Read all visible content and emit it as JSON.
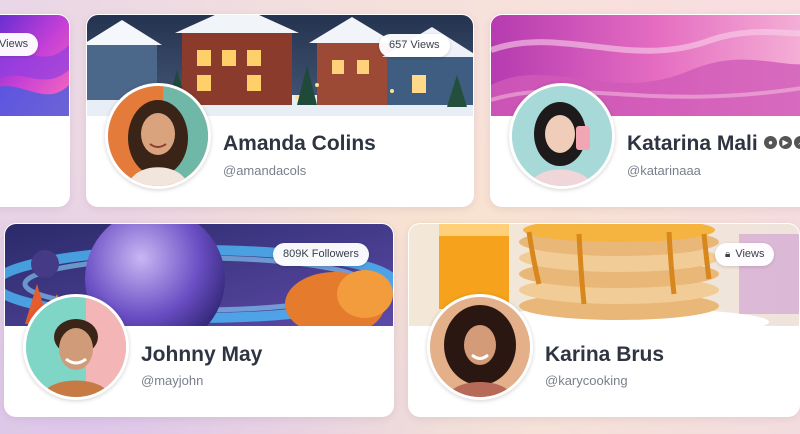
{
  "cards": {
    "partial_left": {
      "badge": "Views"
    },
    "amanda": {
      "name": "Amanda Colins",
      "handle": "@amandacols",
      "badge": "657 Views"
    },
    "katarina": {
      "name": "Katarina Mali",
      "handle": "@katarinaaa"
    },
    "johnny": {
      "name": "Johnny May",
      "handle": "@mayjohn",
      "badge": "809K Followers"
    },
    "karina": {
      "name": "Karina Brus",
      "handle": "@karycooking",
      "badge": "Views"
    }
  },
  "icons": {
    "lock": "lock-icon",
    "social": [
      "circle-icon",
      "play-icon",
      "link-icon"
    ]
  },
  "colors": {
    "name_text": "#2f3441",
    "handle_text": "#7a7f8c",
    "card_bg": "#ffffff"
  }
}
